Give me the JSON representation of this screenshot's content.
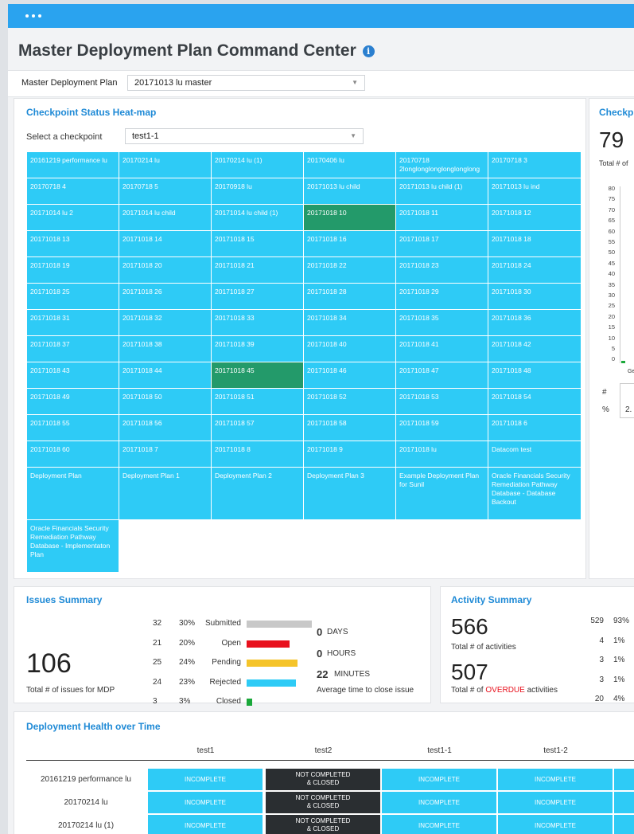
{
  "window": {
    "menu_dots": "• • •"
  },
  "page": {
    "title": "Master Deployment Plan Command Center",
    "info_icon": "i"
  },
  "mdp": {
    "label": "Master Deployment Plan",
    "value": "20171013 lu master"
  },
  "heatmap": {
    "title": "Checkpoint Status Heat-map",
    "select_label": "Select a checkpoint",
    "select_value": "test1-1",
    "cells": [
      {
        "t": "20161219 performance lu"
      },
      {
        "t": "20170214 lu"
      },
      {
        "t": "20170214 lu (1)"
      },
      {
        "t": "20170406 lu"
      },
      {
        "t": "20170718 2longlonglonglonglonglong"
      },
      {
        "t": "20170718 3"
      },
      {
        "t": "20170718 4"
      },
      {
        "t": "20170718 5"
      },
      {
        "t": "20170918 lu"
      },
      {
        "t": "20171013 lu child"
      },
      {
        "t": "20171013 lu child (1)"
      },
      {
        "t": "20171013 lu ind"
      },
      {
        "t": "20171014 lu 2"
      },
      {
        "t": "20171014 lu child"
      },
      {
        "t": "20171014 lu child (1)"
      },
      {
        "t": "20171018 10",
        "dark": true
      },
      {
        "t": "20171018 11"
      },
      {
        "t": "20171018 12"
      },
      {
        "t": "20171018 13"
      },
      {
        "t": "20171018 14"
      },
      {
        "t": "20171018 15"
      },
      {
        "t": "20171018 16"
      },
      {
        "t": "20171018 17"
      },
      {
        "t": "20171018 18"
      },
      {
        "t": "20171018 19"
      },
      {
        "t": "20171018 20"
      },
      {
        "t": "20171018 21"
      },
      {
        "t": "20171018 22"
      },
      {
        "t": "20171018 23"
      },
      {
        "t": "20171018 24"
      },
      {
        "t": "20171018 25"
      },
      {
        "t": "20171018 26"
      },
      {
        "t": "20171018 27"
      },
      {
        "t": "20171018 28"
      },
      {
        "t": "20171018 29"
      },
      {
        "t": "20171018 30"
      },
      {
        "t": "20171018 31"
      },
      {
        "t": "20171018 32"
      },
      {
        "t": "20171018 33"
      },
      {
        "t": "20171018 34"
      },
      {
        "t": "20171018 35"
      },
      {
        "t": "20171018 36"
      },
      {
        "t": "20171018 37"
      },
      {
        "t": "20171018 38"
      },
      {
        "t": "20171018 39"
      },
      {
        "t": "20171018 40"
      },
      {
        "t": "20171018 41"
      },
      {
        "t": "20171018 42"
      },
      {
        "t": "20171018 43"
      },
      {
        "t": "20171018 44"
      },
      {
        "t": "20171018 45",
        "dark": true
      },
      {
        "t": "20171018 46"
      },
      {
        "t": "20171018 47"
      },
      {
        "t": "20171018 48"
      },
      {
        "t": "20171018 49"
      },
      {
        "t": "20171018 50"
      },
      {
        "t": "20171018 51"
      },
      {
        "t": "20171018 52"
      },
      {
        "t": "20171018 53"
      },
      {
        "t": "20171018 54"
      },
      {
        "t": "20171018 55"
      },
      {
        "t": "20171018 56"
      },
      {
        "t": "20171018 57"
      },
      {
        "t": "20171018 58"
      },
      {
        "t": "20171018 59"
      },
      {
        "t": "20171018 6"
      },
      {
        "t": "20171018 60"
      },
      {
        "t": "20171018 7"
      },
      {
        "t": "20171018 8"
      },
      {
        "t": "20171018 9"
      },
      {
        "t": "20171018 lu"
      },
      {
        "t": "Datacom test"
      },
      {
        "t": "Deployment Plan",
        "tall": true
      },
      {
        "t": "Deployment Plan 1",
        "tall": true
      },
      {
        "t": "Deployment Plan 2",
        "tall": true
      },
      {
        "t": "Deployment Plan 3",
        "tall": true
      },
      {
        "t": "Example Deployment Plan for Sunil",
        "tall": true
      },
      {
        "t": "Oracle Financials Security Remediation Pathway Database - Database Backout",
        "tall": true
      },
      {
        "t": "Oracle Financials Security Remediation Pathway Database - Implementaton Plan",
        "tall": true
      }
    ]
  },
  "checkpoint": {
    "title": "Checkp",
    "total": "79",
    "total_label": "Total # of",
    "axis_ticks": [
      "80",
      "75",
      "70",
      "65",
      "60",
      "55",
      "50",
      "45",
      "40",
      "35",
      "30",
      "25",
      "20",
      "15",
      "10",
      "5",
      "0"
    ],
    "x_label": "Ge",
    "table_row1": "#",
    "table_row2": "%",
    "table_val1": "",
    "table_val2": "2."
  },
  "issues": {
    "title": "Issues Summary",
    "total": "106",
    "total_label": "Total # of issues for MDP",
    "rows": [
      {
        "count": "32",
        "pct": "30%",
        "label": "Submitted",
        "color": "#c8c8c8",
        "fill": 1.0
      },
      {
        "count": "21",
        "pct": "20%",
        "label": "Open",
        "color": "#e8101c",
        "fill": 0.66
      },
      {
        "count": "25",
        "pct": "24%",
        "label": "Pending",
        "color": "#f5c42a",
        "fill": 0.78
      },
      {
        "count": "24",
        "pct": "23%",
        "label": "Rejected",
        "color": "#2ecbf6",
        "fill": 0.75
      },
      {
        "count": "3",
        "pct": "3%",
        "label": "Closed",
        "color": "#1aa83a",
        "fill": 0.09
      }
    ],
    "days_val": "0",
    "days_unit": "DAYS",
    "hours_val": "0",
    "hours_unit": "HOURS",
    "min_val": "22",
    "min_unit": "MINUTES",
    "avg_label": "Average time to close issue"
  },
  "activity": {
    "title": "Activity Summary",
    "total": "566",
    "total_label": "Total # of activities",
    "overdue": "507",
    "overdue_prefix": "Total # of",
    "overdue_word": "OVERDUE",
    "overdue_suffix": "activities",
    "rows": [
      {
        "count": "529",
        "pct": "93%"
      },
      {
        "count": "4",
        "pct": "1%"
      },
      {
        "count": "3",
        "pct": "1%"
      },
      {
        "count": "3",
        "pct": "1%"
      },
      {
        "count": "20",
        "pct": "4%"
      }
    ]
  },
  "health": {
    "title": "Deployment Health over Time",
    "columns": [
      "test1",
      "test2",
      "test1-1",
      "test1-2"
    ],
    "rows": [
      {
        "label": "20161219 performance lu",
        "cells": [
          "INCOMPLETE",
          "NOT COMPLETED|& CLOSED",
          "INCOMPLETE",
          "INCOMPLETE"
        ]
      },
      {
        "label": "20170214 lu",
        "cells": [
          "INCOMPLETE",
          "NOT COMPLETED|& CLOSED",
          "INCOMPLETE",
          "INCOMPLETE"
        ]
      },
      {
        "label": "20170214 lu (1)",
        "cells": [
          "INCOMPLETE",
          "NOT COMPLETED|& CLOSED",
          "INCOMPLETE",
          "INCOMPLETE"
        ]
      }
    ]
  },
  "colors": {
    "accent": "#1f8ad6",
    "heat": "#2ecbf6",
    "heat_dark": "#239a6a",
    "overdue": "#e8101c"
  }
}
